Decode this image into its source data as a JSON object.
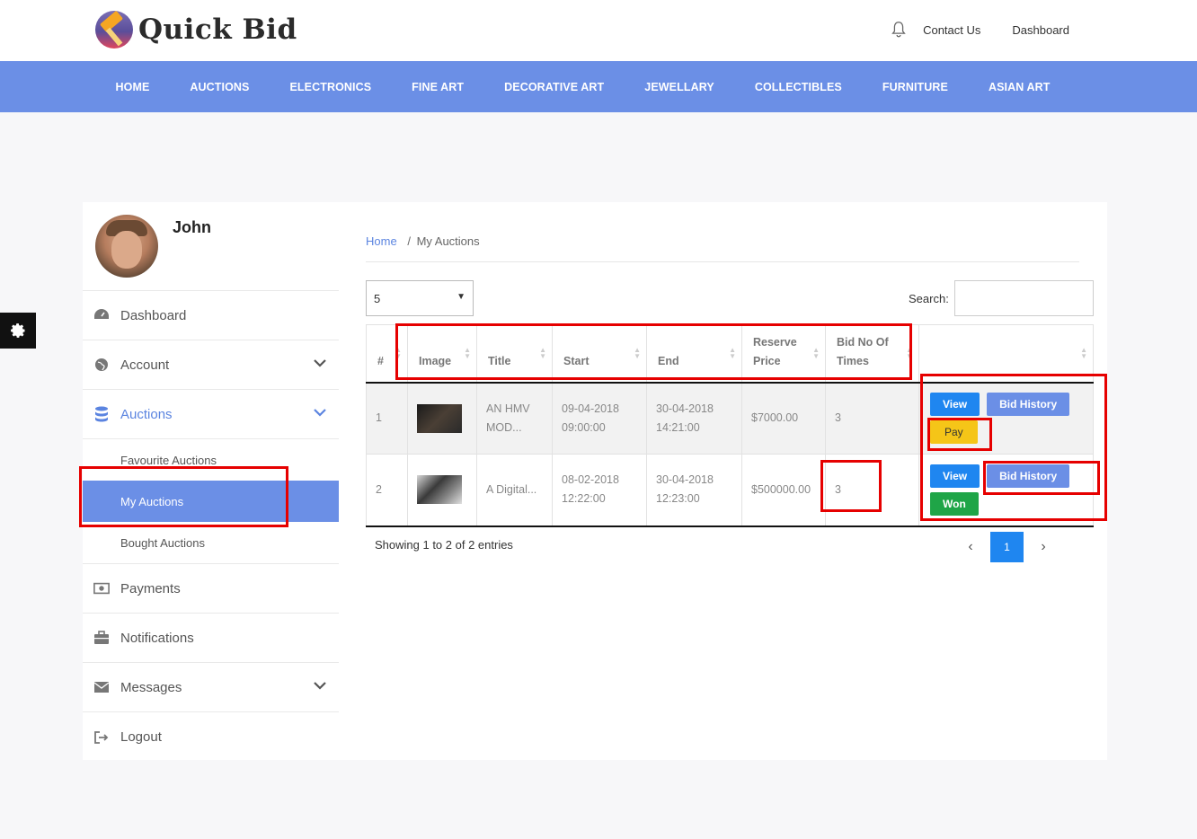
{
  "brand": {
    "name": "Quick Bid"
  },
  "top_links": {
    "contact": "Contact Us",
    "dashboard": "Dashboard"
  },
  "nav": [
    "HOME",
    "AUCTIONS",
    "ELECTRONICS",
    "FINE ART",
    "DECORATIVE ART",
    "JEWELLARY",
    "COLLECTIBLES",
    "FURNITURE",
    "ASIAN ART"
  ],
  "sidebar": {
    "user": "John",
    "items": {
      "dashboard": "Dashboard",
      "account": "Account",
      "auctions": "Auctions",
      "favourite": "Favourite Auctions",
      "my_auctions": "My Auctions",
      "bought": "Bought Auctions",
      "payments": "Payments",
      "notifications": "Notifications",
      "messages": "Messages",
      "logout": "Logout"
    }
  },
  "breadcrumb": {
    "home": "Home",
    "separator": "/",
    "current": "My Auctions"
  },
  "table_controls": {
    "page_length": "5",
    "search_label": "Search:"
  },
  "table": {
    "headers": [
      "#",
      "Image",
      "Title",
      "Start",
      "End",
      "Reserve Price",
      "Bid No Of Times",
      ""
    ],
    "header_lines": {
      "reserve_1": "Reserve",
      "reserve_2": "Price",
      "bidno_1": "Bid No Of",
      "bidno_2": "Times"
    },
    "rows": [
      {
        "no": "1",
        "title_1": "AN HMV",
        "title_2": "MOD...",
        "start_date": "09-04-2018",
        "start_time": "09:00:00",
        "end_date": "30-04-2018",
        "end_time": "14:21:00",
        "reserve": "$7000.00",
        "bids": "3",
        "actions": [
          "View",
          "Bid History",
          "Pay"
        ]
      },
      {
        "no": "2",
        "title_1": "A Digital...",
        "title_2": "",
        "start_date": "08-02-2018",
        "start_time": "12:22:00",
        "end_date": "30-04-2018",
        "end_time": "12:23:00",
        "reserve": "$500000.00",
        "bids": "3",
        "actions": [
          "View",
          "Bid History",
          "Won"
        ]
      }
    ]
  },
  "footer": {
    "info": "Showing 1 to 2 of 2 entries",
    "prev": "‹",
    "page": "1",
    "next": "›"
  },
  "colors": {
    "accent": "#6b8fe6",
    "primary_btn": "#1f86f0",
    "pay": "#f5c518",
    "won": "#1fa547",
    "annotation": "#e60000"
  }
}
